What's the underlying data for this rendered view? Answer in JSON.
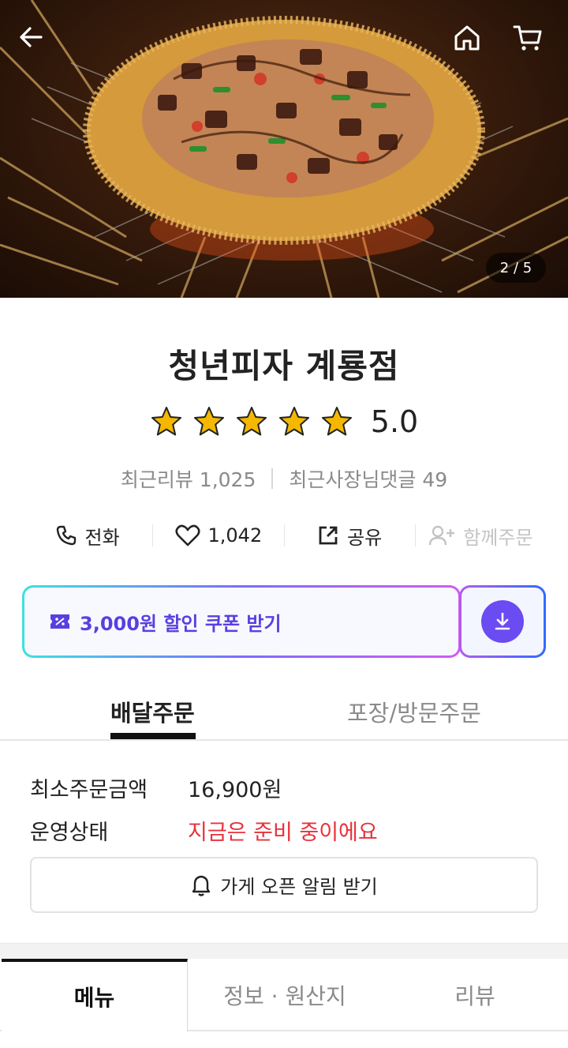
{
  "header": {
    "image_counter": "2 / 5",
    "back_icon": "arrow-left-icon",
    "home_icon": "home-icon",
    "cart_icon": "cart-icon"
  },
  "store": {
    "name": "청년피자 계룡점",
    "rating": "5.0",
    "stars": 5,
    "recent_reviews": "최근리뷰 1,025",
    "owner_replies": "최근사장님댓글 49"
  },
  "actions": {
    "call": "전화",
    "likes": "1,042",
    "share": "공유",
    "group_order": "함께주문"
  },
  "coupon": {
    "label": "3,000원 할인 쿠폰 받기"
  },
  "order_tabs": {
    "delivery": "배달주문",
    "pickup": "포장/방문주문"
  },
  "info": {
    "min_order_label": "최소주문금액",
    "min_order_value": "16,900원",
    "status_label": "운영상태",
    "status_value": "지금은 준비 중이에요"
  },
  "notify": {
    "label": "가게 오픈 알림 받기"
  },
  "bottom_tabs": {
    "menu": "메뉴",
    "info": "정보 · 원산지",
    "reviews": "리뷰"
  },
  "colors": {
    "status_red": "#e8323c",
    "coupon_purple": "#5a3fe0",
    "star_gold": "#f5b800"
  }
}
